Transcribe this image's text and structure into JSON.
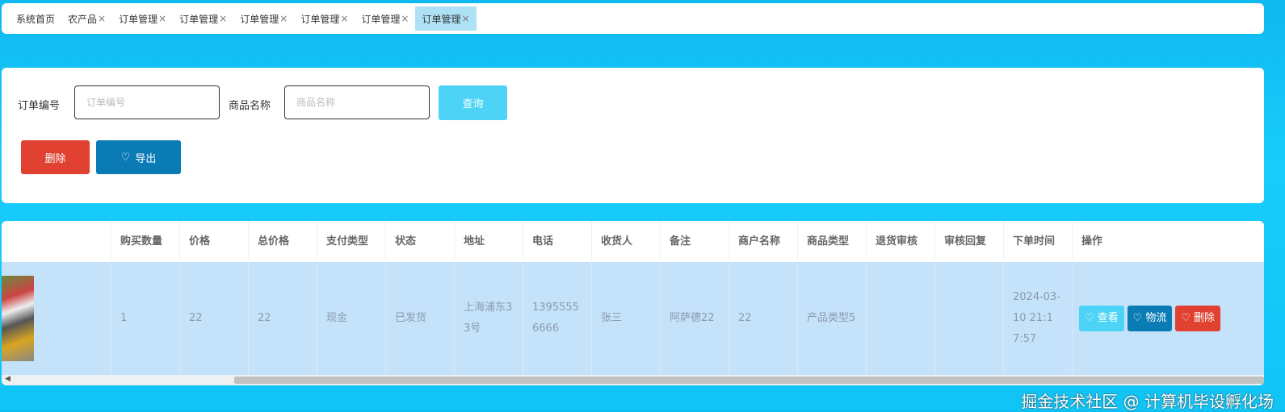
{
  "tabs": [
    {
      "label": "系统首页",
      "closable": false
    },
    {
      "label": "农产品",
      "closable": true
    },
    {
      "label": "订单管理",
      "closable": true
    },
    {
      "label": "订单管理",
      "closable": true
    },
    {
      "label": "订单管理",
      "closable": true
    },
    {
      "label": "订单管理",
      "closable": true
    },
    {
      "label": "订单管理",
      "closable": true
    },
    {
      "label": "订单管理",
      "closable": true,
      "active": true
    }
  ],
  "close_glyph": "×",
  "search": {
    "order_no_label": "订单编号",
    "order_no_placeholder": "订单编号",
    "order_no_value": "",
    "product_label": "商品名称",
    "product_placeholder": "商品名称",
    "product_value": "",
    "query_label": "查询",
    "delete_label": "删除",
    "export_label": "导出"
  },
  "table": {
    "headers": [
      "",
      "购买数量",
      "价格",
      "总价格",
      "支付类型",
      "状态",
      "地址",
      "电话",
      "收货人",
      "备注",
      "商户名称",
      "商品类型",
      "退货审核",
      "审核回复",
      "下单时间",
      "操作"
    ],
    "rows": [
      {
        "qty": "1",
        "price": "22",
        "total": "22",
        "pay": "现金",
        "status": "已发货",
        "address": "上海浦东33号",
        "phone": "13955556666",
        "receiver": "张三",
        "remark": "阿萨德22",
        "merchant": "22",
        "type": "产品类型5",
        "return_audit": "",
        "audit_reply": "",
        "time": "2024-03-10 21:17:57",
        "actions": {
          "view": "查看",
          "logistics": "物流",
          "delete": "删除"
        }
      }
    ]
  },
  "watermark": "掘金技术社区 @ 计算机毕设孵化场",
  "colors": {
    "accent": "#0a7bb5",
    "danger": "#e04130",
    "info": "#4dd3f5",
    "row_highlight": "#c5e2fb"
  }
}
